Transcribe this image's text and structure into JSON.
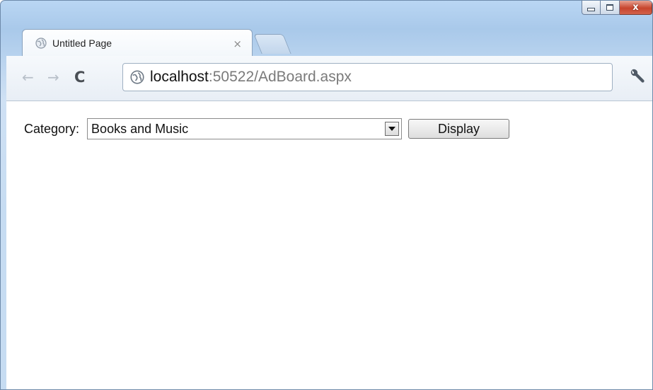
{
  "window": {
    "caption_buttons": {
      "minimize_icon": "minimize-icon",
      "maximize_icon": "maximize-icon",
      "close_glyph": "x"
    }
  },
  "tab": {
    "title": "Untitled Page",
    "close_glyph": "×",
    "icon": "globe-icon"
  },
  "toolbar": {
    "back_glyph": "←",
    "forward_glyph": "→",
    "reload_glyph": "C",
    "address": {
      "host": "localhost",
      "path": ":50522/AdBoard.aspx",
      "icon": "globe-icon"
    },
    "menu_icon": "wrench-icon"
  },
  "form": {
    "category_label": "Category:",
    "category_selected": "Books and Music",
    "display_button": "Display"
  },
  "colors": {
    "frame": "#b9d6f3",
    "close_button": "#c7452d"
  }
}
